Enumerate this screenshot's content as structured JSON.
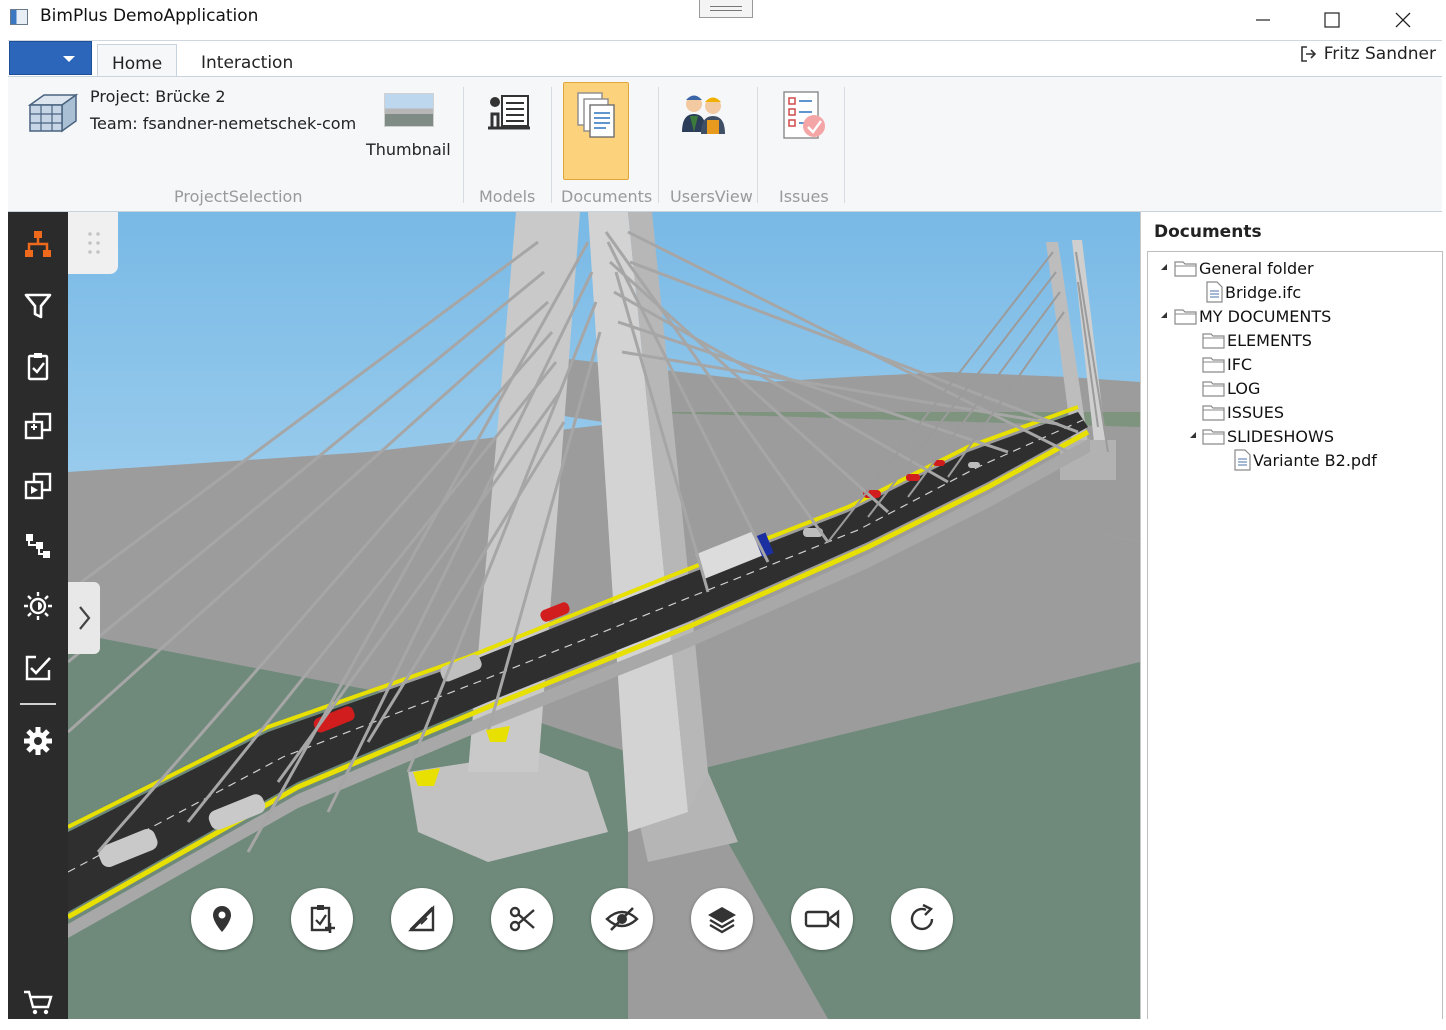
{
  "window": {
    "title": "BimPlus DemoApplication",
    "minimize_icon": "minimize-icon",
    "maximize_icon": "maximize-icon",
    "close_icon": "close-icon"
  },
  "ribbon": {
    "tabs": [
      {
        "label": "Home",
        "selected": true
      },
      {
        "label": "Interaction",
        "selected": false
      }
    ],
    "user": {
      "name": "Fritz Sandner",
      "icon": "logout-icon"
    },
    "project_selection": {
      "project": "Project: Brücke 2",
      "team": "Team: fsandner-nemetschek-com",
      "thumbnail_label": "Thumbnail",
      "group_label": "ProjectSelection"
    },
    "groups": {
      "models": "Models",
      "documents": "Documents",
      "usersview": "UsersView",
      "issues": "Issues"
    },
    "active_group": "Documents",
    "accent_color": "#fdd27c"
  },
  "left_toolbar": {
    "items": [
      {
        "icon": "hierarchy-icon",
        "active": true,
        "color": "#f06a1e"
      },
      {
        "icon": "filter-icon"
      },
      {
        "icon": "clipboard-check-icon"
      },
      {
        "icon": "copy-layers-icon"
      },
      {
        "icon": "play-layers-icon"
      },
      {
        "icon": "tree-structure-icon"
      },
      {
        "icon": "brightness-icon"
      },
      {
        "icon": "edit-check-icon"
      },
      {
        "icon": "settings-icon"
      },
      {
        "icon": "cart-icon"
      }
    ]
  },
  "viewport_tools": [
    {
      "icon": "location-pin-icon"
    },
    {
      "icon": "clipboard-add-icon"
    },
    {
      "icon": "measure-icon"
    },
    {
      "icon": "cut-icon"
    },
    {
      "icon": "hide-icon"
    },
    {
      "icon": "layers-icon"
    },
    {
      "icon": "camera-icon"
    },
    {
      "icon": "rotate-icon"
    }
  ],
  "documents": {
    "title": "Documents",
    "tree": [
      {
        "label": "General folder",
        "type": "folder",
        "expanded": true,
        "children": [
          {
            "label": "Bridge.ifc",
            "type": "file"
          }
        ]
      },
      {
        "label": "MY DOCUMENTS",
        "type": "folder",
        "expanded": true,
        "children": [
          {
            "label": "ELEMENTS",
            "type": "folder"
          },
          {
            "label": "IFC",
            "type": "folder"
          },
          {
            "label": "LOG",
            "type": "folder"
          },
          {
            "label": "ISSUES",
            "type": "folder"
          },
          {
            "label": "SLIDESHOWS",
            "type": "folder",
            "expanded": true,
            "children": [
              {
                "label": "Variante B2.pdf",
                "type": "file"
              }
            ]
          }
        ]
      }
    ]
  }
}
